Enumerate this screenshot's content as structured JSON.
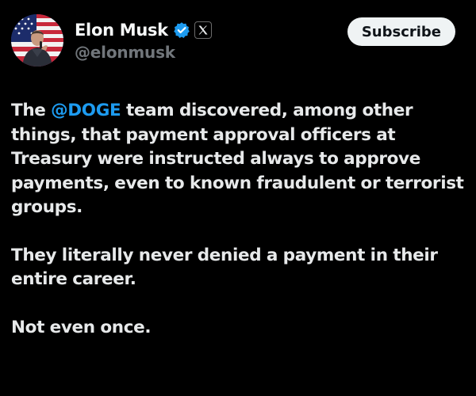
{
  "author": {
    "display_name": "Elon Musk",
    "handle": "@elonmusk",
    "avatar_icon": "profile-photo",
    "verified_icon": "verified-badge-icon",
    "affiliation_icon": "x-logo-icon"
  },
  "actions": {
    "subscribe_label": "Subscribe"
  },
  "tweet": {
    "p1_before": "The ",
    "p1_mention": "@DOGE",
    "p1_after": " team discovered, among other things, that payment approval officers at Treasury were instructed always to approve payments, even to known fraudulent or terrorist groups.",
    "p2": "They literally never denied a payment in their entire career.",
    "p3": "Not even once."
  },
  "colors": {
    "background": "#000000",
    "text": "#e7e9ea",
    "handle": "#71767b",
    "mention": "#1d9bf0",
    "verified": "#1d9bf0",
    "button_bg": "#eff3f4",
    "button_text": "#0f1419"
  }
}
